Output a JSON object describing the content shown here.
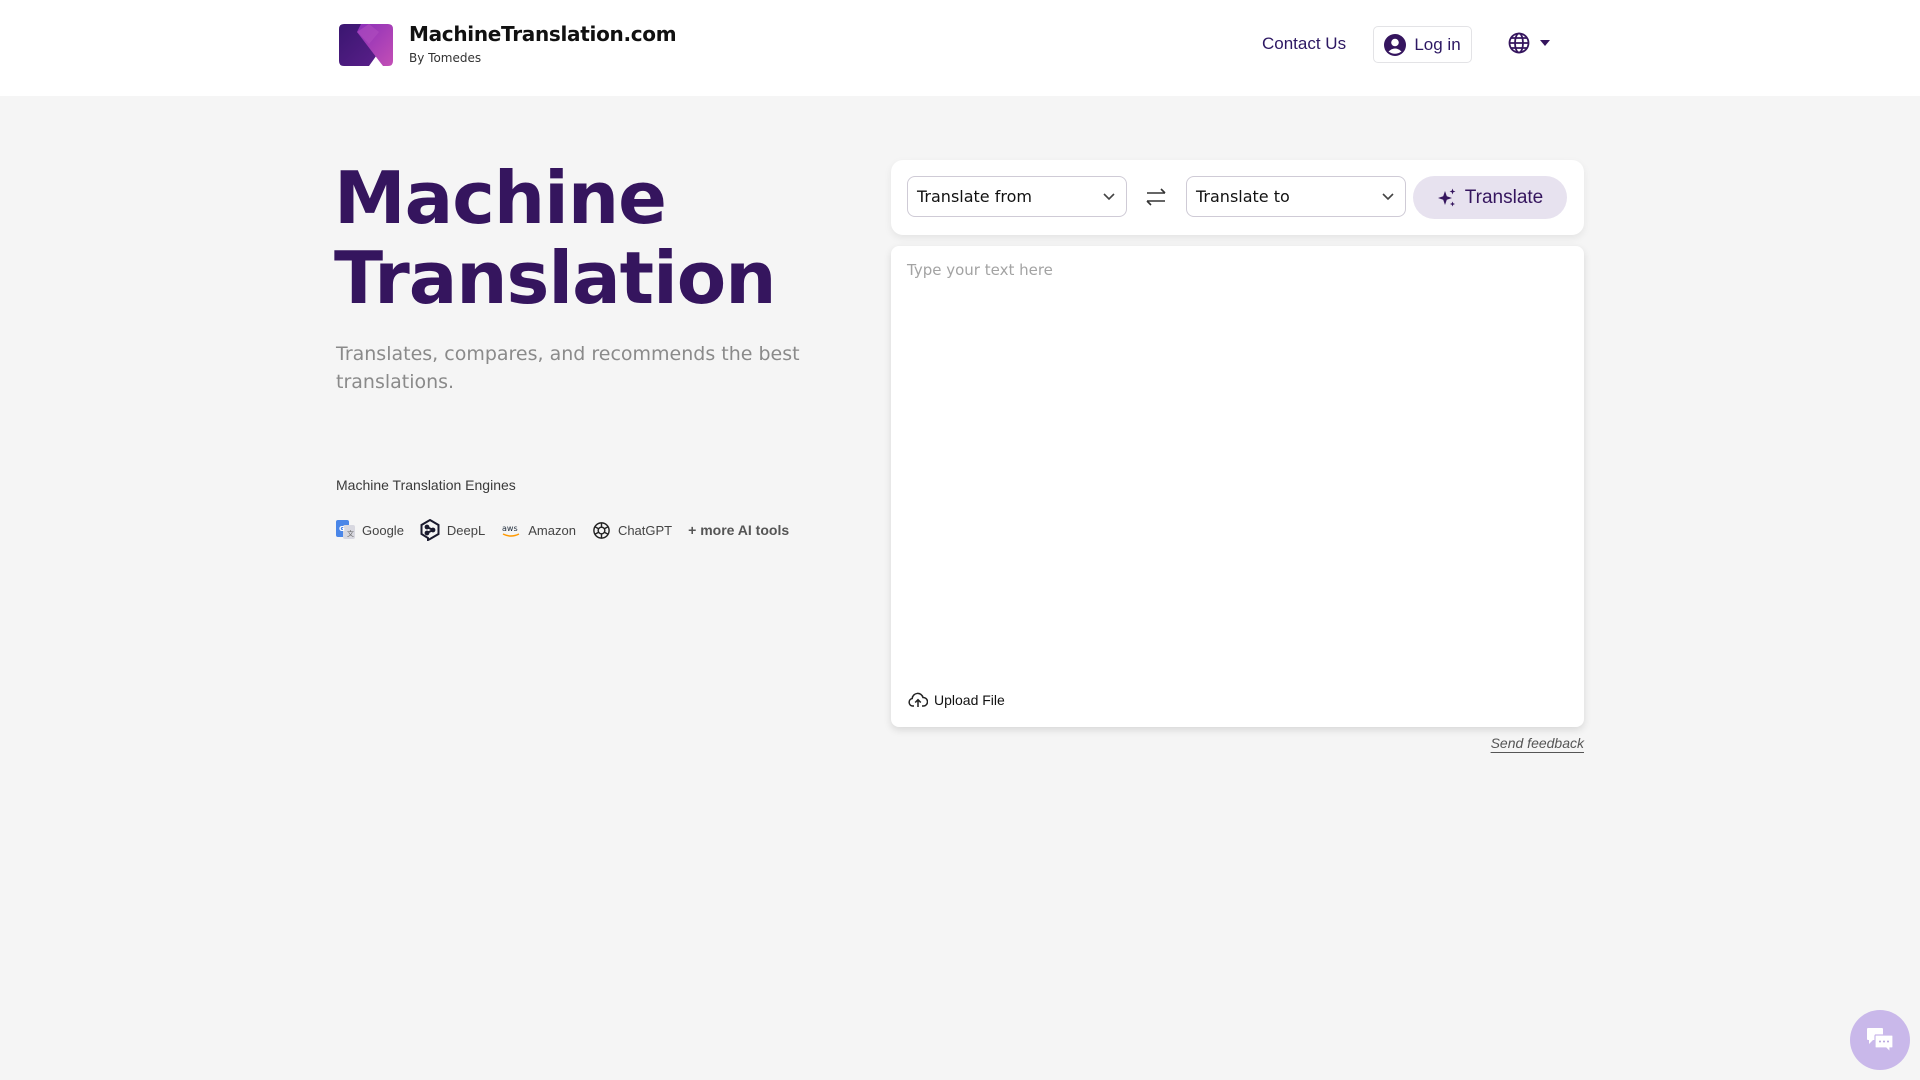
{
  "header": {
    "brand_title": "MachineTranslation.com",
    "brand_subtitle": "By Tomedes",
    "contact_label": "Contact Us",
    "login_label": "Log in",
    "language_icon": "globe-icon"
  },
  "hero": {
    "title_line1": "Machine",
    "title_line2": "Translation",
    "subtitle": "Translates, compares, and recommends the best translations.",
    "engines_label": "Machine Translation Engines",
    "engines": [
      {
        "name": "Google",
        "icon": "google-translate-icon"
      },
      {
        "name": "DeepL",
        "icon": "deepl-icon"
      },
      {
        "name": "Amazon",
        "icon": "aws-icon"
      },
      {
        "name": "ChatGPT",
        "icon": "chatgpt-icon"
      }
    ],
    "more_tools": "+ more AI tools"
  },
  "translator": {
    "from_label": "Translate from",
    "to_label": "Translate to",
    "translate_button": "Translate",
    "text_placeholder": "Type your text here",
    "text_value": "",
    "upload_label": "Upload File",
    "feedback_label": "Send feedback"
  },
  "colors": {
    "brand_purple": "#35155e",
    "accent_light": "#e7e2ef",
    "chat_bubble": "#c9b8ea",
    "background": "#f5f5f5"
  }
}
